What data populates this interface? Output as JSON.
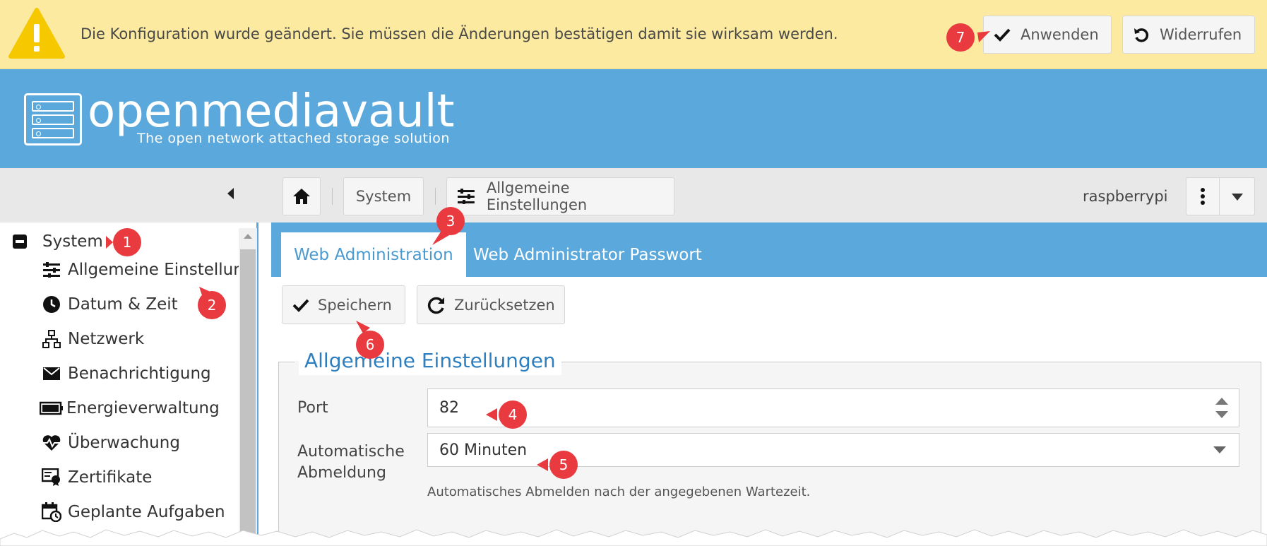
{
  "banner": {
    "message": "Die Konfiguration wurde geändert. Sie müssen die Änderungen bestätigen damit sie wirksam werden.",
    "apply_label": "Anwenden",
    "revert_label": "Widerrufen",
    "icon": "warning-icon"
  },
  "header": {
    "logo_title": "openmediavault",
    "logo_subtitle": "The open network attached storage solution"
  },
  "toolbar": {
    "breadcrumb": [
      "System",
      "Allgemeine Einstellungen"
    ],
    "hostname": "raspberrypi"
  },
  "sidebar": {
    "root": "System",
    "items": [
      {
        "label": "Allgemeine Einstellung",
        "icon": "sliders-icon"
      },
      {
        "label": "Datum & Zeit",
        "icon": "clock-icon"
      },
      {
        "label": "Netzwerk",
        "icon": "network-icon"
      },
      {
        "label": "Benachrichtigung",
        "icon": "mail-icon"
      },
      {
        "label": "Energieverwaltung",
        "icon": "battery-icon"
      },
      {
        "label": "Überwachung",
        "icon": "heart-pulse-icon"
      },
      {
        "label": "Zertifikate",
        "icon": "certificate-icon"
      },
      {
        "label": "Geplante Aufgaben",
        "icon": "calendar-clock-icon"
      }
    ]
  },
  "tabs": [
    "Web Administration",
    "Web Administrator Passwort"
  ],
  "actions": {
    "save_label": "Speichern",
    "reset_label": "Zurücksetzen"
  },
  "form": {
    "legend": "Allgemeine Einstellungen",
    "port_label": "Port",
    "port_value": "82",
    "logout_label_line1": "Automatische",
    "logout_label_line2": "Abmeldung",
    "logout_value": "60 Minuten",
    "logout_hint": "Automatisches Abmelden nach der angegebenen Wartezeit."
  },
  "callouts": [
    "1",
    "2",
    "3",
    "4",
    "5",
    "6",
    "7"
  ],
  "colors": {
    "banner_bg": "#fbeaa0",
    "header_blue": "#5ba9dc",
    "callout_red": "#e83a3f",
    "legend_blue": "#2e7fbf"
  }
}
